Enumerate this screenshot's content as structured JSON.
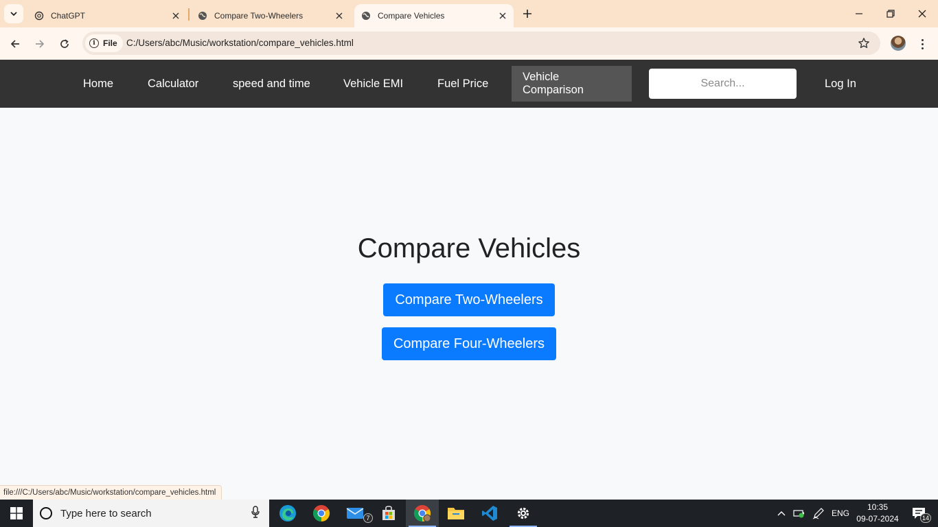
{
  "browser": {
    "tabs": [
      {
        "title": "ChatGPT",
        "active": false
      },
      {
        "title": "Compare Two-Wheelers",
        "active": false
      },
      {
        "title": "Compare Vehicles",
        "active": true
      }
    ],
    "chip_label": "File",
    "url": "C:/Users/abc/Music/workstation/compare_vehicles.html",
    "status_url": "file:///C:/Users/abc/Music/workstation/compare_vehicles.html"
  },
  "site_nav": {
    "links": [
      {
        "label": "Home",
        "active": false
      },
      {
        "label": "Calculator",
        "active": false
      },
      {
        "label": "speed and time",
        "active": false
      },
      {
        "label": "Vehicle EMI",
        "active": false
      },
      {
        "label": "Fuel Price",
        "active": false
      },
      {
        "label": "Vehicle Comparison",
        "active": true
      }
    ],
    "search_placeholder": "Search...",
    "login_label": "Log In"
  },
  "main": {
    "title": "Compare Vehicles",
    "buttons": {
      "two_wheelers": "Compare Two-Wheelers",
      "four_wheelers": "Compare Four-Wheelers"
    }
  },
  "taskbar": {
    "search_placeholder": "Type here to search",
    "mail_badge": "7",
    "language": "ENG",
    "time": "10:35",
    "date": "09-07-2024",
    "notification_count": "14"
  },
  "colors": {
    "tabbar_bg": "#fbe3cb",
    "navbar_bg": "#333333",
    "nav_active_bg": "#555555",
    "primary_button": "#0a7bff",
    "page_bg": "#f8f9fa",
    "taskbar_bg": "#1e2227"
  }
}
